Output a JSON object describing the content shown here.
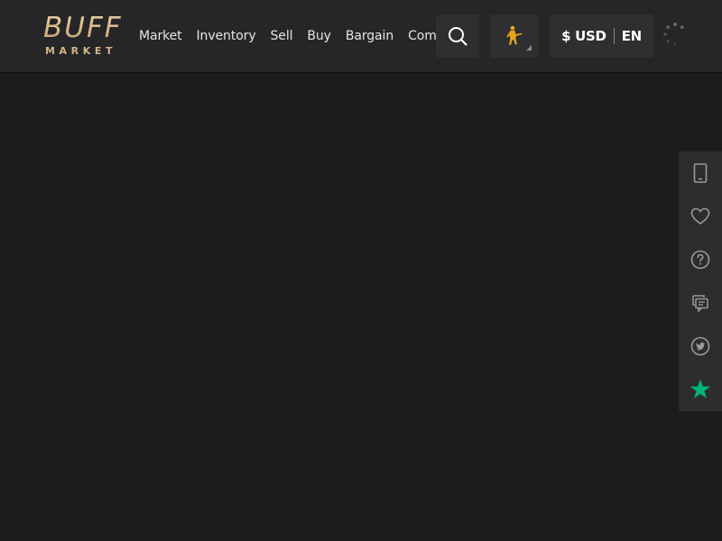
{
  "logo": {
    "main": "BUFF",
    "sub": "MARKET"
  },
  "nav": {
    "items": [
      {
        "label": "Market"
      },
      {
        "label": "Inventory"
      },
      {
        "label": "Sell"
      },
      {
        "label": "Buy"
      },
      {
        "label": "Bargain"
      },
      {
        "label": "Community"
      }
    ]
  },
  "header": {
    "currency": "$ USD",
    "language": "EN"
  },
  "colors": {
    "header_bg": "#262628",
    "page_bg": "#1c1c1e",
    "gold": "#d3b585",
    "game_icon": "#e8a317",
    "trustpilot_green": "#00b67a",
    "side_icon": "#9a9a9a"
  },
  "sidebar": {
    "icons": [
      "tablet-icon",
      "heart-icon",
      "help-icon",
      "chat-icon",
      "twitter-icon",
      "trustpilot-star-icon"
    ]
  }
}
